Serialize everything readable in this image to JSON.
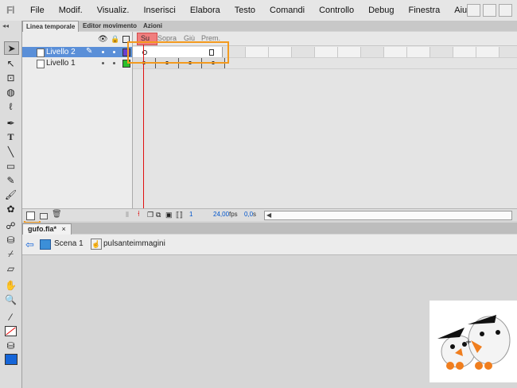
{
  "app": {
    "logo": "Fl"
  },
  "menubar": {
    "items": [
      "File",
      "Modif.",
      "Visualiz.",
      "Inserisci",
      "Elabora",
      "Testo",
      "Comandi",
      "Controllo",
      "Debug",
      "Finestra",
      "Aiuto"
    ]
  },
  "panel_tabs": [
    "Linea temporale",
    "Editor movimento",
    "Azioni"
  ],
  "frame_header": {
    "su": "Su",
    "sopra": "Sopra",
    "giu": "Giù",
    "prem": "Prem."
  },
  "layers": [
    {
      "name": "Livello 2",
      "selected": true,
      "color": "#6a3fcf"
    },
    {
      "name": "Livello 1",
      "selected": false,
      "color": "#2bbf2b"
    }
  ],
  "timeline_status": {
    "frame": "1",
    "fps": "24,00",
    "fps_unit": "fps",
    "time": "0,0",
    "time_unit": "s"
  },
  "document_tab": "gufo.fla*",
  "breadcrumb": {
    "scene": "Scena 1",
    "symbol": "pulsanteimmagini"
  },
  "colors": {
    "highlight": "#f39a1e",
    "playhead": "#e01010",
    "selected_layer": "#5a8fd8"
  }
}
